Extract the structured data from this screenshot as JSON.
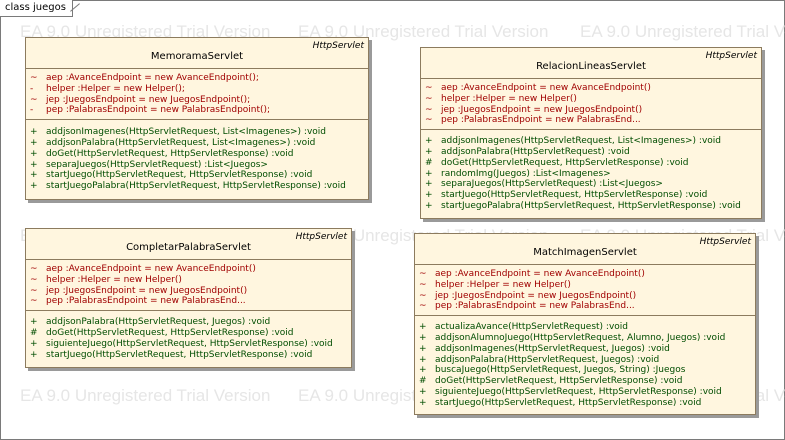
{
  "frame": {
    "label": "class juegos"
  },
  "watermark": {
    "text": "EA 9.0 Unregistered Trial Version"
  },
  "classes": [
    {
      "id": "memorama",
      "stereotype": "HttpServlet",
      "name": "MemoramaServlet",
      "attributes": [
        {
          "vis": "~",
          "text": "aep  :AvanceEndpoint = new AvanceEndpoint();"
        },
        {
          "vis": "-",
          "text": "helper  :Helper = new Helper();"
        },
        {
          "vis": "~",
          "text": "jep  :JuegosEndpoint = new JuegosEndpoint();"
        },
        {
          "vis": "-",
          "text": "pep  :PalabrasEndpoint = new PalabrasEndpoint();"
        }
      ],
      "methods": [
        {
          "vis": "+",
          "text": "addjsonImagenes(HttpServletRequest, List<Imagenes>)  :void"
        },
        {
          "vis": "+",
          "text": "addjsonPalabra(HttpServletRequest, List<Imagenes>)  :void"
        },
        {
          "vis": "+",
          "text": "doGet(HttpServletRequest, HttpServletResponse)  :void"
        },
        {
          "vis": "+",
          "text": "separaJuegos(HttpServletRequest)  :List<Juegos>"
        },
        {
          "vis": "+",
          "text": "startJuego(HttpServletRequest, HttpServletResponse)  :void"
        },
        {
          "vis": "+",
          "text": "startJuegoPalabra(HttpServletRequest, HttpServletResponse)  :void"
        }
      ]
    },
    {
      "id": "relacion",
      "stereotype": "HttpServlet",
      "name": "RelacionLineasServlet",
      "attributes": [
        {
          "vis": "~",
          "text": "aep  :AvanceEndpoint = new AvanceEndpoint()"
        },
        {
          "vis": "~",
          "text": "helper  :Helper = new Helper()"
        },
        {
          "vis": "~",
          "text": "jep  :JuegosEndpoint = new JuegosEndpoint()"
        },
        {
          "vis": "~",
          "text": "pep  :PalabrasEndpoint = new PalabrasEnd..."
        }
      ],
      "methods": [
        {
          "vis": "+",
          "text": "addjsonImagenes(HttpServletRequest, List<Imagenes>)  :void"
        },
        {
          "vis": "+",
          "text": "addjsonPalabra(HttpServletRequest)  :void"
        },
        {
          "vis": "#",
          "text": "doGet(HttpServletRequest, HttpServletResponse)  :void"
        },
        {
          "vis": "+",
          "text": "randomImg(Juegos)  :List<Imagenes>"
        },
        {
          "vis": "+",
          "text": "separaJuegos(HttpServletRequest)  :List<Juegos>"
        },
        {
          "vis": "+",
          "text": "startJuego(HttpServletRequest, HttpServletResponse)  :void"
        },
        {
          "vis": "+",
          "text": "startJuegoPalabra(HttpServletRequest, HttpServletResponse)  :void"
        }
      ]
    },
    {
      "id": "completar",
      "stereotype": "HttpServlet",
      "name": "CompletarPalabraServlet",
      "attributes": [
        {
          "vis": "~",
          "text": "aep  :AvanceEndpoint = new AvanceEndpoint()"
        },
        {
          "vis": "~",
          "text": "helper  :Helper = new Helper()"
        },
        {
          "vis": "~",
          "text": "jep  :JuegosEndpoint = new JuegosEndpoint()"
        },
        {
          "vis": "~",
          "text": "pep  :PalabrasEndpoint = new PalabrasEnd..."
        }
      ],
      "methods": [
        {
          "vis": "+",
          "text": "addjsonPalabra(HttpServletRequest, Juegos)  :void"
        },
        {
          "vis": "#",
          "text": "doGet(HttpServletRequest, HttpServletResponse)  :void"
        },
        {
          "vis": "+",
          "text": "siguienteJuego(HttpServletRequest, HttpServletResponse)  :void"
        },
        {
          "vis": "+",
          "text": "startJuego(HttpServletRequest, HttpServletResponse)  :void"
        }
      ]
    },
    {
      "id": "match",
      "stereotype": "HttpServlet",
      "name": "MatchImagenServlet",
      "attributes": [
        {
          "vis": "~",
          "text": "aep  :AvanceEndpoint = new AvanceEndpoint()"
        },
        {
          "vis": "~",
          "text": "helper  :Helper = new Helper()"
        },
        {
          "vis": "~",
          "text": "jep  :JuegosEndpoint = new JuegosEndpoint()"
        },
        {
          "vis": "~",
          "text": "pep  :PalabrasEndpoint = new PalabrasEnd..."
        }
      ],
      "methods": [
        {
          "vis": "+",
          "text": "actualizaAvance(HttpServletRequest)  :void"
        },
        {
          "vis": "+",
          "text": "addjsonAlumnoJuego(HttpServletRequest, Alumno, Juegos)  :void"
        },
        {
          "vis": "+",
          "text": "addjsonImagenes(HttpServletRequest, Juegos)  :void"
        },
        {
          "vis": "+",
          "text": "addjsonPalabra(HttpServletRequest, Juegos)  :void"
        },
        {
          "vis": "+",
          "text": "buscaJuego(HttpServletRequest, Juegos, String)  :Juegos"
        },
        {
          "vis": "#",
          "text": "doGet(HttpServletRequest, HttpServletResponse)  :void"
        },
        {
          "vis": "+",
          "text": "siguienteJuego(HttpServletRequest, HttpServletResponse)  :void"
        },
        {
          "vis": "+",
          "text": "startJuego(HttpServletRequest, HttpServletResponse)  :void"
        }
      ]
    }
  ]
}
